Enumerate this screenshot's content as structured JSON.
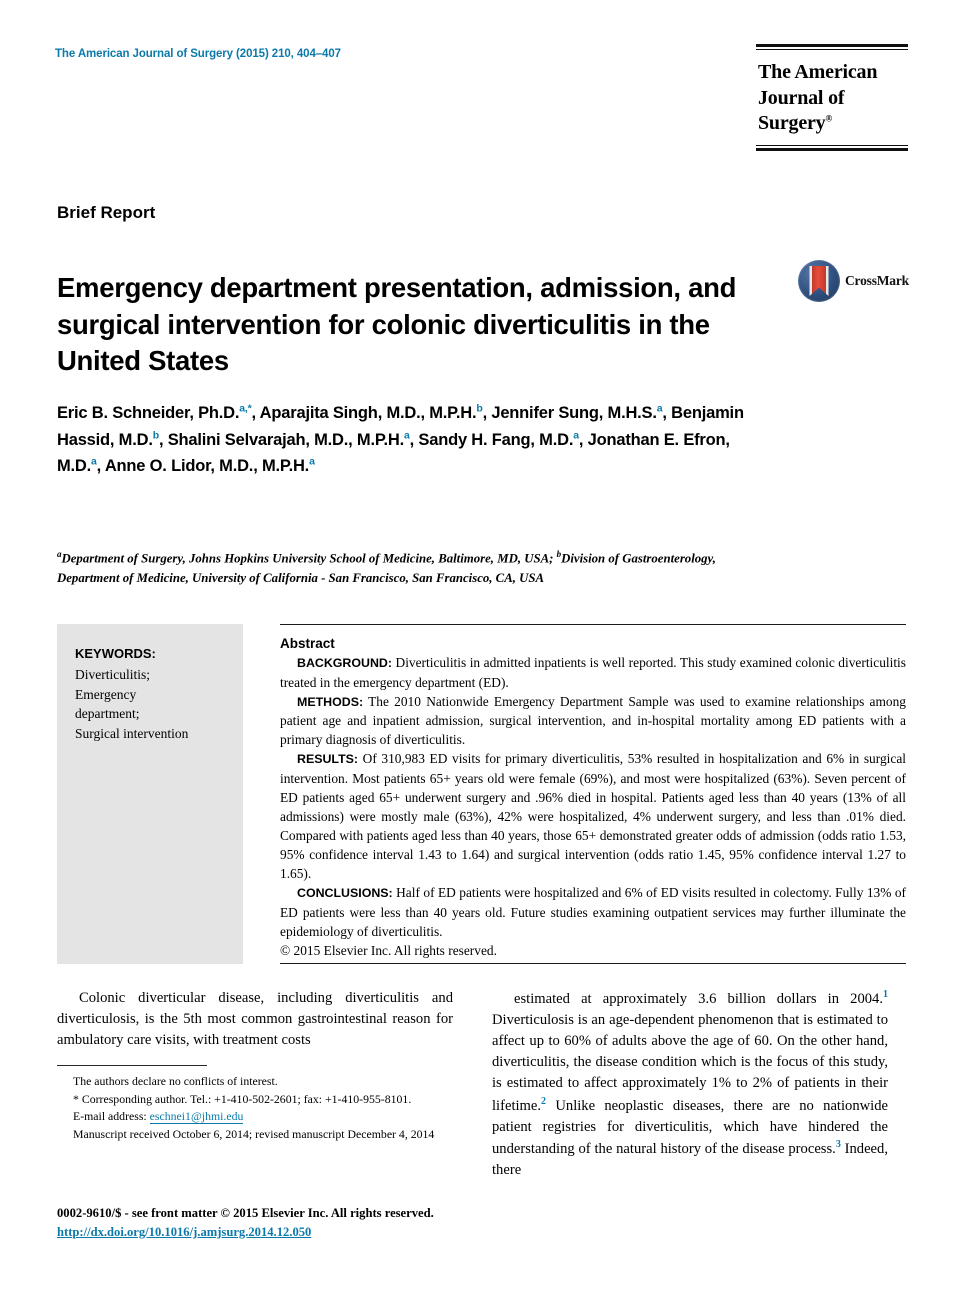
{
  "running_head": "The American Journal of Surgery (2015) 210, 404–407",
  "journal_logo": {
    "line1": "The American",
    "line2": "Journal of Surgery",
    "registered_mark": "®"
  },
  "section_label": "Brief Report",
  "title": "Emergency department presentation, admission, and surgical intervention for colonic diverticulitis in the United States",
  "crossmark": {
    "label": "CrossMark",
    "icon": "crossmark-icon"
  },
  "authors_html": "Eric B. Schneider, Ph.D.<sup>a,*</sup>, Aparajita Singh, M.D., M.P.H.<sup>b</sup>, Jennifer Sung, M.H.S.<sup>a</sup>, Benjamin Hassid, M.D.<sup>b</sup>, Shalini Selvarajah, M.D., M.P.H.<sup>a</sup>, Sandy H. Fang, M.D.<sup>a</sup>, Jonathan E. Efron, M.D.<sup>a</sup>, Anne O. Lidor, M.D., M.P.H.<sup>a</sup>",
  "authors_plain": "Eric B. Schneider, Ph.D.a,*, Aparajita Singh, M.D., M.P.H.b, Jennifer Sung, M.H.S.a, Benjamin Hassid, M.D.b, Shalini Selvarajah, M.D., M.P.H.a, Sandy H. Fang, M.D.a, Jonathan E. Efron, M.D.a, Anne O. Lidor, M.D., M.P.H.a",
  "affiliations_html": "<sup>a</sup>Department of Surgery, Johns Hopkins University School of Medicine, Baltimore, MD, USA; <sup>b</sup>Division of Gastroenterology, Department of Medicine, University of California - San Francisco, San Francisco, CA, USA",
  "keywords": {
    "heading": "KEYWORDS:",
    "items": [
      "Diverticulitis;",
      "Emergency",
      "department;",
      "Surgical intervention"
    ],
    "text": "Diverticulitis; Emergency department; Surgical intervention"
  },
  "abstract": {
    "heading": "Abstract",
    "sections": [
      {
        "label": "BACKGROUND:",
        "body": "Diverticulitis in admitted inpatients is well reported. This study examined colonic diverticulitis treated in the emergency department (ED)."
      },
      {
        "label": "METHODS:",
        "body": "The 2010 Nationwide Emergency Department Sample was used to examine relationships among patient age and inpatient admission, surgical intervention, and in-hospital mortality among ED patients with a primary diagnosis of diverticulitis."
      },
      {
        "label": "RESULTS:",
        "body": "Of 310,983 ED visits for primary diverticulitis, 53% resulted in hospitalization and 6% in surgical intervention. Most patients 65+ years old were female (69%), and most were hospitalized (63%). Seven percent of ED patients aged 65+ underwent surgery and .96% died in hospital. Patients aged less than 40 years (13% of all admissions) were mostly male (63%), 42% were hospitalized, 4% underwent surgery, and less than .01% died. Compared with patients aged less than 40 years, those 65+ demonstrated greater odds of admission (odds ratio 1.53, 95% confidence interval 1.43 to 1.64) and surgical intervention (odds ratio 1.45, 95% confidence interval 1.27 to 1.65)."
      },
      {
        "label": "CONCLUSIONS:",
        "body": "Half of ED patients were hospitalized and 6% of ED visits resulted in colectomy. Fully 13% of ED patients were less than 40 years old. Future studies examining outpatient services may further illuminate the epidemiology of diverticulitis."
      }
    ],
    "copyright": "© 2015 Elsevier Inc. All rights reserved."
  },
  "body": {
    "left_column": "Colonic diverticular disease, including diverticulitis and diverticulosis, is the 5th most common gastrointestinal reason for ambulatory care visits, with treatment costs",
    "right_column_html": "estimated at approximately 3.6 billion dollars in 2004.<sup class=\"ref\">1</sup> Diverticulosis is an age-dependent phenomenon that is estimated to affect up to 60% of adults above the age of 60. On the other hand, diverticulitis, the disease condition which is the focus of this study, is estimated to affect approximately 1% to 2% of patients in their lifetime.<sup class=\"ref\">2</sup> Unlike neoplastic diseases, there are no nationwide patient registries for diverticulitis, which have hindered the understanding of the natural history of the disease process.<sup class=\"ref\">3</sup> Indeed, there"
  },
  "footnotes": {
    "conflict": "The authors declare no conflicts of interest.",
    "corresponding_html": "<span class=\"star\">*</span> Corresponding author. Tel.: +1-410-502-2601; fax: +1-410-955-8101.",
    "corresponding_plain": "* Corresponding author. Tel.: +1-410-502-2601; fax: +1-410-955-8101.",
    "email_label": "E-mail address:",
    "email": "eschnei1@jhmi.edu",
    "received": "Manuscript received October 6, 2014; revised manuscript December 4, 2014"
  },
  "footer": {
    "issn_line": "0002-9610/$ - see front matter © 2015 Elsevier Inc. All rights reserved.",
    "doi": "http://dx.doi.org/10.1016/j.amjsurg.2014.12.050"
  },
  "colors": {
    "accent_blue": "#0b7aab",
    "keyword_box_gray": "#e4e4e4",
    "crossmark_circle": "#1d3557",
    "crossmark_ribbon": "#c0392b"
  }
}
